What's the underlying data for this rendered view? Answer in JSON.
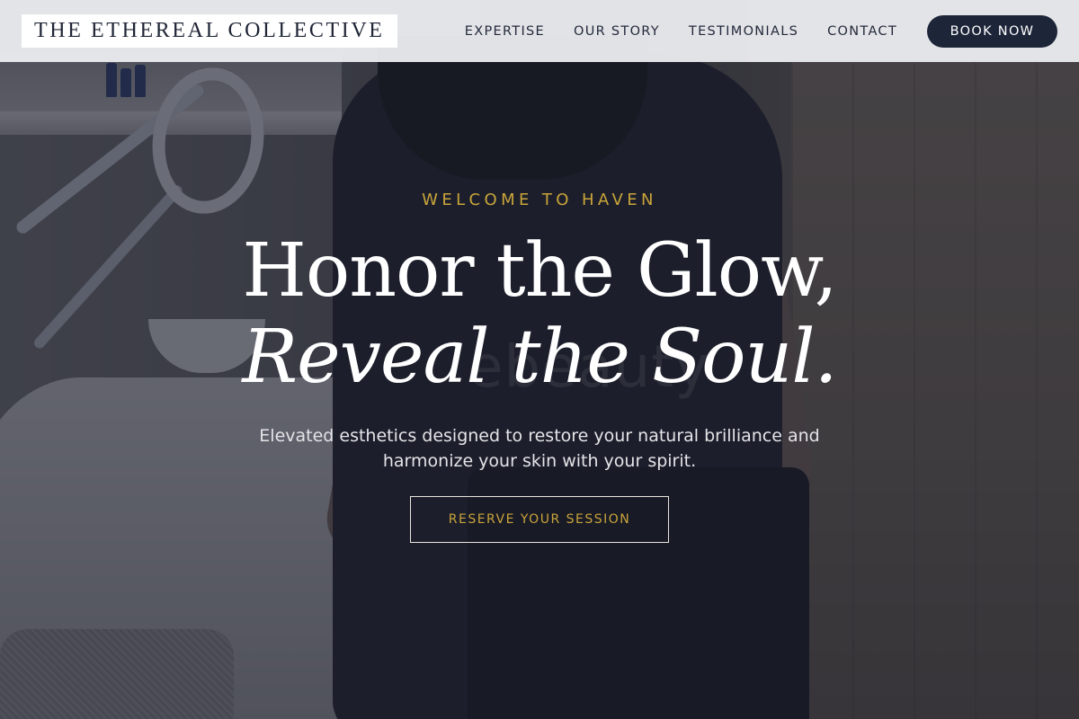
{
  "header": {
    "logo_text": "THE ETHEREAL COLLECTIVE",
    "nav": [
      {
        "label": "EXPERTISE"
      },
      {
        "label": "OUR STORY"
      },
      {
        "label": "TESTIMONIALS"
      },
      {
        "label": "CONTACT"
      }
    ],
    "book_button": "BOOK NOW"
  },
  "hero": {
    "eyebrow": "WELCOME TO HAVEN",
    "headline_line1": "Honor the Glow,",
    "headline_line2": "Reveal the Soul.",
    "subhead": "Elevated esthetics designed to restore your natural brilliance and harmonize your skin with your spirit.",
    "cta": "RESERVE YOUR SESSION",
    "background_watermark": "ebeauty"
  },
  "colors": {
    "accent_gold": "#c9a43a",
    "navy": "#1d2539",
    "header_bg": "#ecedf0"
  }
}
